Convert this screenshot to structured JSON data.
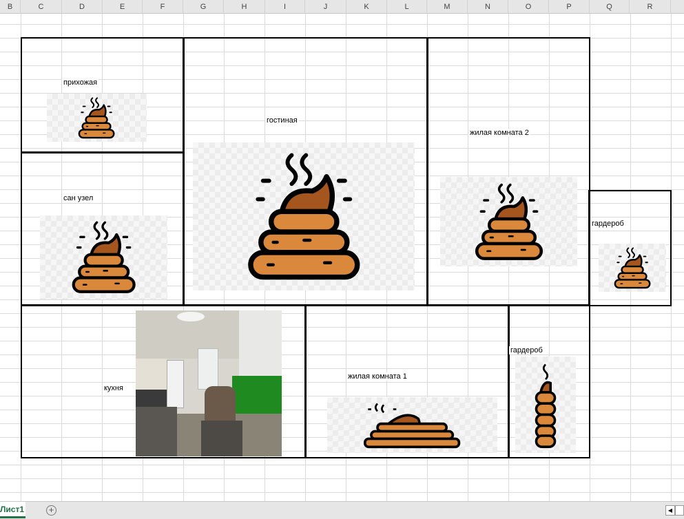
{
  "columns": [
    "B",
    "C",
    "D",
    "E",
    "F",
    "G",
    "H",
    "I",
    "J",
    "K",
    "L",
    "M",
    "N",
    "O",
    "P",
    "Q",
    "R"
  ],
  "rooms": {
    "hallway": "прихожая",
    "bathroom": "сан узел",
    "living_room": "гостиная",
    "bedroom2": "жилая комната 2",
    "wardrobe1": "гардероб",
    "kitchen": "кухня",
    "bedroom1": "жилая комната 1",
    "wardrobe2": "гардероб"
  },
  "sheet_tab": "Лист1",
  "add_sheet_icon": "plus-circle-icon",
  "colors": {
    "poop_light": "#d9883c",
    "poop_dark": "#a5561f",
    "outline": "#000000",
    "accent": "#217346"
  }
}
